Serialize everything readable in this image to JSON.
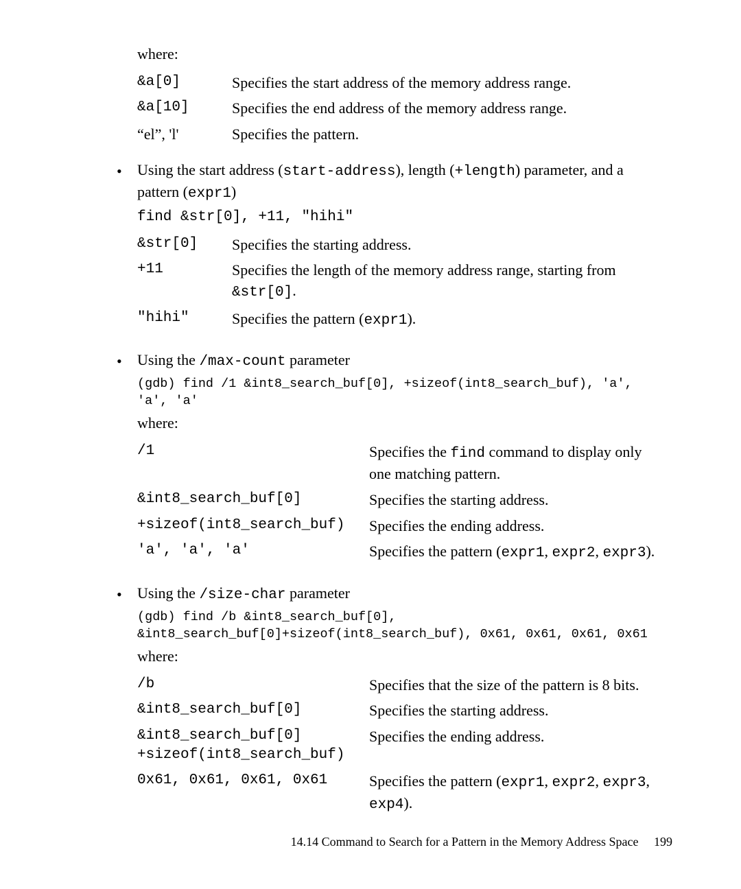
{
  "intro_where": "where:",
  "defs_intro": [
    {
      "term": "&a[0]",
      "desc": "Specifies the start address of the memory address range."
    },
    {
      "term": "&a[10]",
      "desc": "Specifies the end address of the memory address range."
    },
    {
      "term": "“el”, 'l'",
      "desc": "Specifies the pattern."
    }
  ],
  "bullet1": {
    "lead_pre": "Using the start address (",
    "lead_c1": "start-address",
    "lead_mid1": "), length (",
    "lead_c2": "+length",
    "lead_mid2": ") parameter, and a pattern (",
    "lead_c3": "expr1",
    "lead_post": ")",
    "code": "find &str[0], +11, \"hihi\"",
    "defs": [
      {
        "term": "&str[0]",
        "desc": "Specifies the starting address."
      },
      {
        "term": "+11",
        "desc_pre": "Specifies the length of the memory address range, starting from ",
        "desc_code": "&str[0]",
        "desc_post": "."
      },
      {
        "term": "\"hihi\"",
        "desc_pre": "Specifies the pattern (",
        "desc_code": "expr1",
        "desc_post": ")."
      }
    ]
  },
  "bullet2": {
    "lead_pre": "Using the ",
    "lead_c1": "/max-count",
    "lead_post": " parameter",
    "code": "(gdb) find /1 &int8_search_buf[0], +sizeof(int8_search_buf), 'a', 'a', 'a'",
    "where": "where:",
    "defs": [
      {
        "term": "/1",
        "desc_pre": "Specifies the ",
        "desc_code": "find",
        "desc_post": " command to display only one matching pattern."
      },
      {
        "term": "&int8_search_buf[0]",
        "desc": "Specifies the starting address."
      },
      {
        "term": "+sizeof(int8_search_buf)",
        "desc": "Specifies the ending address."
      },
      {
        "term": "'a', 'a', 'a'",
        "desc_pre": "Specifies the pattern (",
        "desc_code": "expr1",
        "desc_mid": ", ",
        "desc_code2": "expr2",
        "desc_mid2": ", ",
        "desc_code3": "expr3",
        "desc_post": ")."
      }
    ]
  },
  "bullet3": {
    "lead_pre": "Using the ",
    "lead_c1": "/size-char",
    "lead_post": " parameter",
    "code": "(gdb) find /b &int8_search_buf[0], &int8_search_buf[0]+sizeof(int8_search_buf), 0x61, 0x61, 0x61, 0x61",
    "where": "where:",
    "defs": [
      {
        "term": "/b",
        "desc": "Specifies that the size of the pattern is 8 bits."
      },
      {
        "term": "&int8_search_buf[0]",
        "desc": "Specifies the starting address."
      },
      {
        "term_l1": "&int8_search_buf[0]",
        "term_l2": "+sizeof(int8_search_buf)",
        "desc": "Specifies the ending address."
      },
      {
        "term": "0x61, 0x61, 0x61, 0x61",
        "desc_pre": "Specifies the pattern (",
        "desc_code": "expr1",
        "desc_mid": ", ",
        "desc_code2": "expr2",
        "desc_mid2": ", ",
        "desc_code3": "expr3",
        "desc_mid3": ", ",
        "desc_code4": "exp4",
        "desc_post": ")."
      }
    ]
  },
  "footer": {
    "section": "14.14 Command to Search for a Pattern in the Memory Address Space",
    "page": "199"
  }
}
